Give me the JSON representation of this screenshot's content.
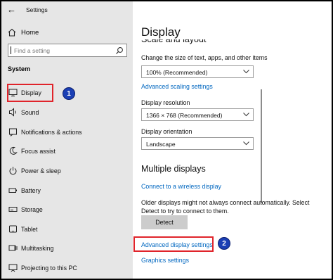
{
  "window": {
    "title": "Settings"
  },
  "sidebar": {
    "home_label": "Home",
    "search_placeholder": "Find a setting",
    "section_label": "System",
    "items": [
      {
        "label": "Display",
        "icon": "monitor-icon"
      },
      {
        "label": "Sound",
        "icon": "speaker-icon"
      },
      {
        "label": "Notifications & actions",
        "icon": "notification-icon"
      },
      {
        "label": "Focus assist",
        "icon": "moon-icon"
      },
      {
        "label": "Power & sleep",
        "icon": "power-icon"
      },
      {
        "label": "Battery",
        "icon": "battery-icon"
      },
      {
        "label": "Storage",
        "icon": "storage-icon"
      },
      {
        "label": "Tablet",
        "icon": "tablet-icon"
      },
      {
        "label": "Multitasking",
        "icon": "multitasking-icon"
      },
      {
        "label": "Projecting to this PC",
        "icon": "projecting-icon"
      }
    ]
  },
  "main": {
    "page_title": "Display",
    "partial_heading": "Scale and layout",
    "scale_label": "Change the size of text, apps, and other items",
    "scale_value": "100% (Recommended)",
    "advanced_scaling_link": "Advanced scaling settings",
    "resolution_label": "Display resolution",
    "resolution_value": "1366 × 768 (Recommended)",
    "orientation_label": "Display orientation",
    "orientation_value": "Landscape",
    "multiple_heading": "Multiple displays",
    "wireless_link": "Connect to a wireless display",
    "detect_desc": "Older displays might not always connect automatically. Select Detect to try to connect to them.",
    "detect_button": "Detect",
    "advanced_display_link": "Advanced display settings",
    "graphics_link": "Graphics settings"
  },
  "annotations": {
    "badge1": "1",
    "badge2": "2"
  },
  "colors": {
    "accent": "#0067c0",
    "annotation_box": "#e0242b",
    "annotation_badge": "#1b3fb4",
    "sidebar_bg": "#e6e6e6"
  }
}
